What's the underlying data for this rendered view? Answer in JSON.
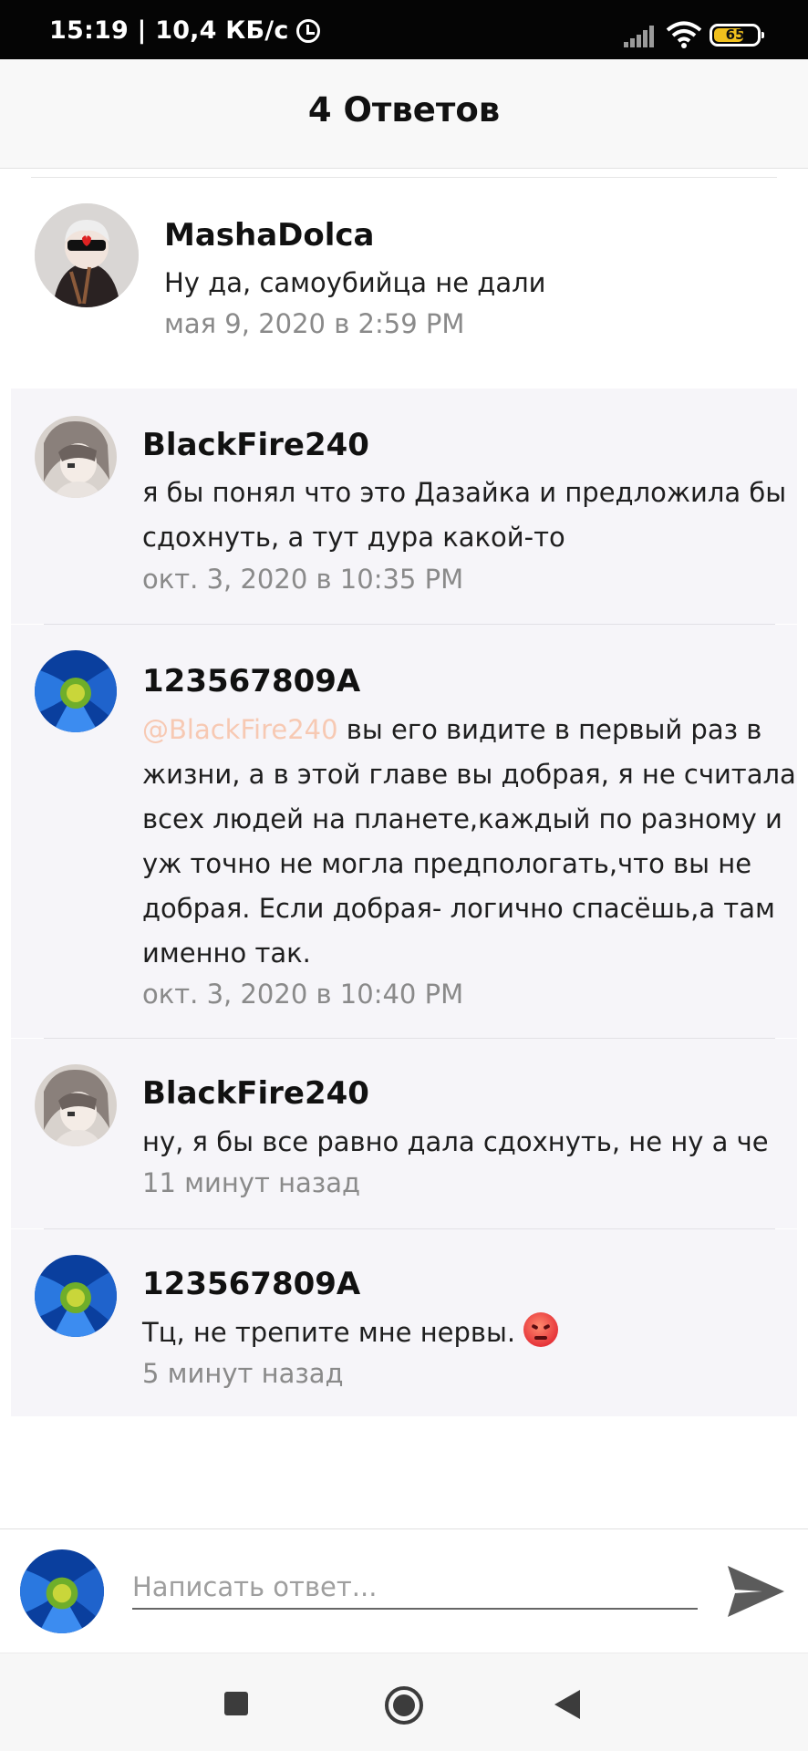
{
  "status_bar": {
    "time_speed": "15:19 | 10,4 КБ/с",
    "battery": "65"
  },
  "header": {
    "title": "4 Ответов"
  },
  "parent_comment": {
    "author": "MashaDolca",
    "text": "Ну да, самоубийца не дали",
    "date": "мая 9, 2020 в 2:59 PM"
  },
  "replies": [
    {
      "author": "BlackFire240",
      "text": "я бы понял что это Дазайка и предложила бы сдохнуть, а тут дура какой-то",
      "date": "окт. 3, 2020 в 10:35 PM"
    },
    {
      "author": "123567809A",
      "mention": "@BlackFire240",
      "text": " вы его видите в первый раз в жизни, а в этой главе вы добрая, я не считала всех людей на планете,каждый по разному и уж точно не могла предпологать,что вы не добрая. Если добрая- логично спасёшь,а там именно так.",
      "date": "окт. 3, 2020 в 10:40 PM"
    },
    {
      "author": "BlackFire240",
      "text": "ну, я бы все равно дала сдохнуть, не ну а че",
      "date": "11 минут назад"
    },
    {
      "author": "123567809A",
      "text": "Тц, не трепите мне нервы. ",
      "emoji": "angry-face",
      "date": "5 минут назад"
    }
  ],
  "composer": {
    "placeholder": "Написать ответ..."
  },
  "icons": {
    "send": "send-icon",
    "nav": [
      "recents-icon",
      "home-icon",
      "back-icon"
    ]
  }
}
